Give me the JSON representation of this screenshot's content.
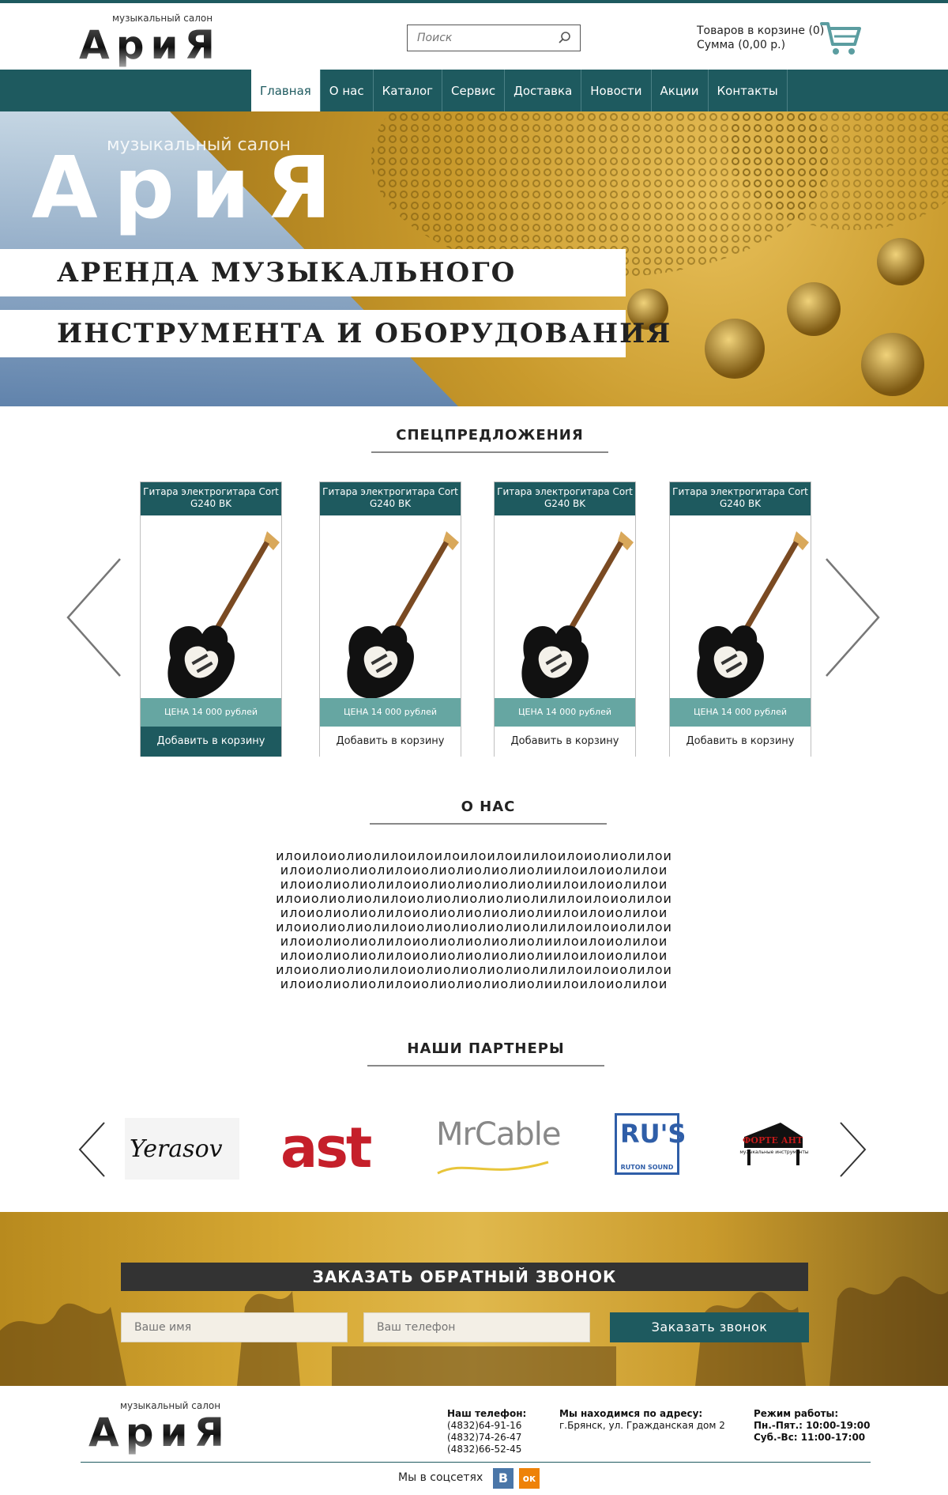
{
  "logo": {
    "subtitle": "музыкальный салон",
    "word": "АриЯ"
  },
  "search": {
    "placeholder": "Поиск"
  },
  "cart": {
    "items_line": "Товаров в корзине (0)",
    "sum_line": "Сумма (0,00 р.)"
  },
  "nav": {
    "items": [
      {
        "label": "Главная"
      },
      {
        "label": "О нас"
      },
      {
        "label": "Каталог"
      },
      {
        "label": "Сервис"
      },
      {
        "label": "Доставка"
      },
      {
        "label": "Новости"
      },
      {
        "label": "Акции"
      },
      {
        "label": "Контакты"
      }
    ]
  },
  "hero": {
    "line1": "АРЕНДА МУЗЫКАЛЬНОГО",
    "line2": "ИНСТРУМЕНТА И ОБОРУДОВАНИЯ"
  },
  "specials": {
    "title": "СПЕЦПРЕДЛОЖЕНИЯ",
    "products": [
      {
        "name": "Гитара электрогитара Cort G240 BK",
        "price": "ЦЕНА 14 000 рублей",
        "button": "Добавить в корзину"
      },
      {
        "name": "Гитара электрогитара Cort G240 BK",
        "price": "ЦЕНА 14 000 рублей",
        "button": "Добавить в корзину"
      },
      {
        "name": "Гитара электрогитара Cort G240 BK",
        "price": "ЦЕНА 14 000 рублей",
        "button": "Добавить в корзину"
      },
      {
        "name": "Гитара электрогитара Cort G240 BK",
        "price": "ЦЕНА 14 000 рублей",
        "button": "Добавить в корзину"
      }
    ]
  },
  "about": {
    "title": "О НАС",
    "lines": [
      "илоилоиолиолилоилоилоилоилоилилоилоиолиолилои",
      "илоиолиолиолилоиолиолиолиолиолиилоилоиолилои",
      "илоиолиолиолилоиолиолиолиолиолиилоилоиолилои",
      "илоиолиолиолилоиолиолиолиолиолилилоилоиолилои",
      "илоиолиолиолилоиолиолиолиолиолиилоилоиолилои",
      "илоиолиолиолилоиолиолиолиолиолилилоилоиолилои",
      "илоиолиолиолилоиолиолиолиолиолиилоилоиолилои",
      "илоиолиолиолилоиолиолиолиолиолиилоилоиолилои",
      "илоиолиолиолилоиолиолиолиолиолилилоилоиолилои",
      "илоиолиолиолилоиолиолиолиолиолиилоилоиолилои"
    ]
  },
  "partners": {
    "title": "НАШИ ПАРТНЕРЫ",
    "logos": [
      {
        "name": "Yerasov"
      },
      {
        "name": "ast"
      },
      {
        "name": "MrCable"
      },
      {
        "name": "RU'S",
        "sub": "RUTON SOUND"
      },
      {
        "name": "ФОРТЕ АНТ",
        "sub": "музыкальные инструменты"
      }
    ]
  },
  "callback": {
    "title": "ЗАКАЗАТЬ ОБРАТНЫЙ ЗВОНОК",
    "name_placeholder": "Ваше имя",
    "phone_placeholder": "Ваш телефон",
    "button": "Заказать звонок"
  },
  "footer": {
    "phone_title": "Наш телефон:",
    "phones": [
      "(4832)64-91-16",
      "(4832)74-26-47",
      "(4832)66-52-45"
    ],
    "address_title": "Мы находимся по адресу:",
    "address": "г.Брянск, ул. Гражданская дом 2",
    "hours_title": "Режим работы:",
    "hours": [
      "Пн.-Пят.: 10:00-19:00",
      "Суб.-Вс: 11:00-17:00"
    ],
    "social_label": "Мы в соцсетях",
    "vk": "В",
    "ok": "ок"
  },
  "colors": {
    "teal": "#1e5a5f",
    "teal_light": "#66a6a2",
    "gold": "#c99a2c",
    "blue": "#6a8fba"
  }
}
